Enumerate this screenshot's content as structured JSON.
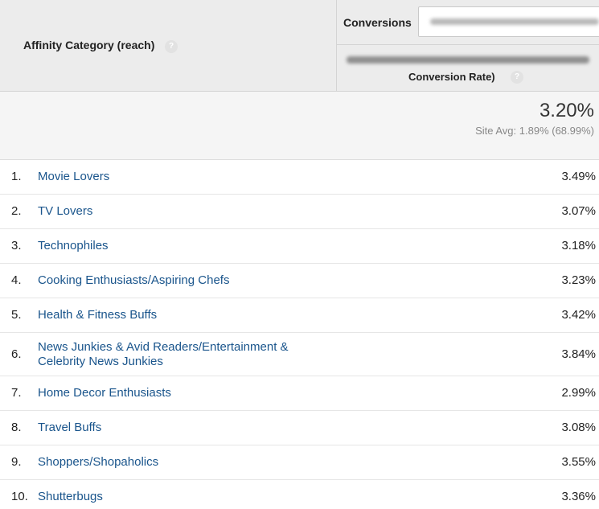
{
  "header": {
    "affinity_label": "Affinity Category (reach)",
    "conversions_label": "Conversions",
    "conversion_rate_label": "Conversion Rate)",
    "help_glyph": "?"
  },
  "summary": {
    "total": "3.20%",
    "site_avg": "Site Avg: 1.89% (68.99%)"
  },
  "rows": [
    {
      "num": "1.",
      "name": "Movie Lovers",
      "value": "3.49%"
    },
    {
      "num": "2.",
      "name": "TV Lovers",
      "value": "3.07%"
    },
    {
      "num": "3.",
      "name": "Technophiles",
      "value": "3.18%"
    },
    {
      "num": "4.",
      "name": "Cooking Enthusiasts/Aspiring Chefs",
      "value": "3.23%"
    },
    {
      "num": "5.",
      "name": "Health & Fitness Buffs",
      "value": "3.42%"
    },
    {
      "num": "6.",
      "name": "News Junkies & Avid Readers/Entertainment & Celebrity News Junkies",
      "value": "3.84%"
    },
    {
      "num": "7.",
      "name": "Home Decor Enthusiasts",
      "value": "2.99%"
    },
    {
      "num": "8.",
      "name": "Travel Buffs",
      "value": "3.08%"
    },
    {
      "num": "9.",
      "name": "Shoppers/Shopaholics",
      "value": "3.55%"
    },
    {
      "num": "10.",
      "name": "Shutterbugs",
      "value": "3.36%"
    }
  ]
}
